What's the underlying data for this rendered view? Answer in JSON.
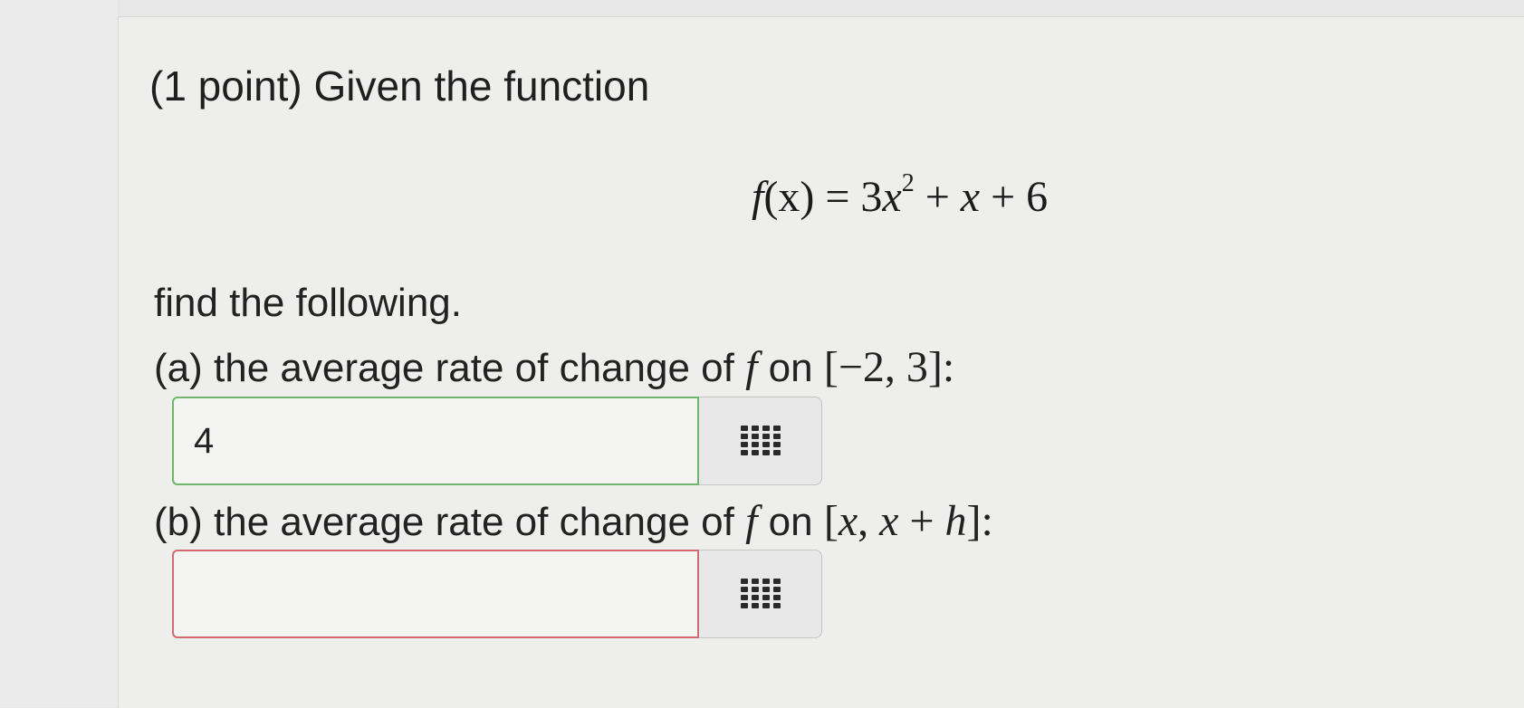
{
  "problem": {
    "prompt": "(1 point) Given the function",
    "equation": {
      "lhs_func": "f",
      "lhs_arg": "(x)",
      "equals": " = 3",
      "var": "x",
      "exponent": "2",
      "rest_1": " + ",
      "rest_var": "x",
      "rest_2": " + 6"
    },
    "find_text": "find the following.",
    "part_a": {
      "label": "(a) the average rate of change of ",
      "func": "f",
      "on": " on ",
      "interval": "[−2, 3]",
      "colon": ":",
      "answer_value": "4",
      "answer_state": "correct"
    },
    "part_b": {
      "label": "(b) the average rate of change of ",
      "func": "f",
      "on": " on ",
      "interval_open": "[",
      "interval_x1": "x",
      "interval_comma": ", ",
      "interval_x2": "x",
      "interval_plus": " + ",
      "interval_h": "h",
      "interval_close": "]",
      "colon": ":",
      "answer_value": "",
      "answer_state": "incorrect"
    }
  },
  "icons": {
    "matrix_button": "matrix-grid-icon"
  },
  "colors": {
    "correct_border": "#6fb56b",
    "incorrect_border": "#cf6b73",
    "background": "#eeeeed"
  }
}
